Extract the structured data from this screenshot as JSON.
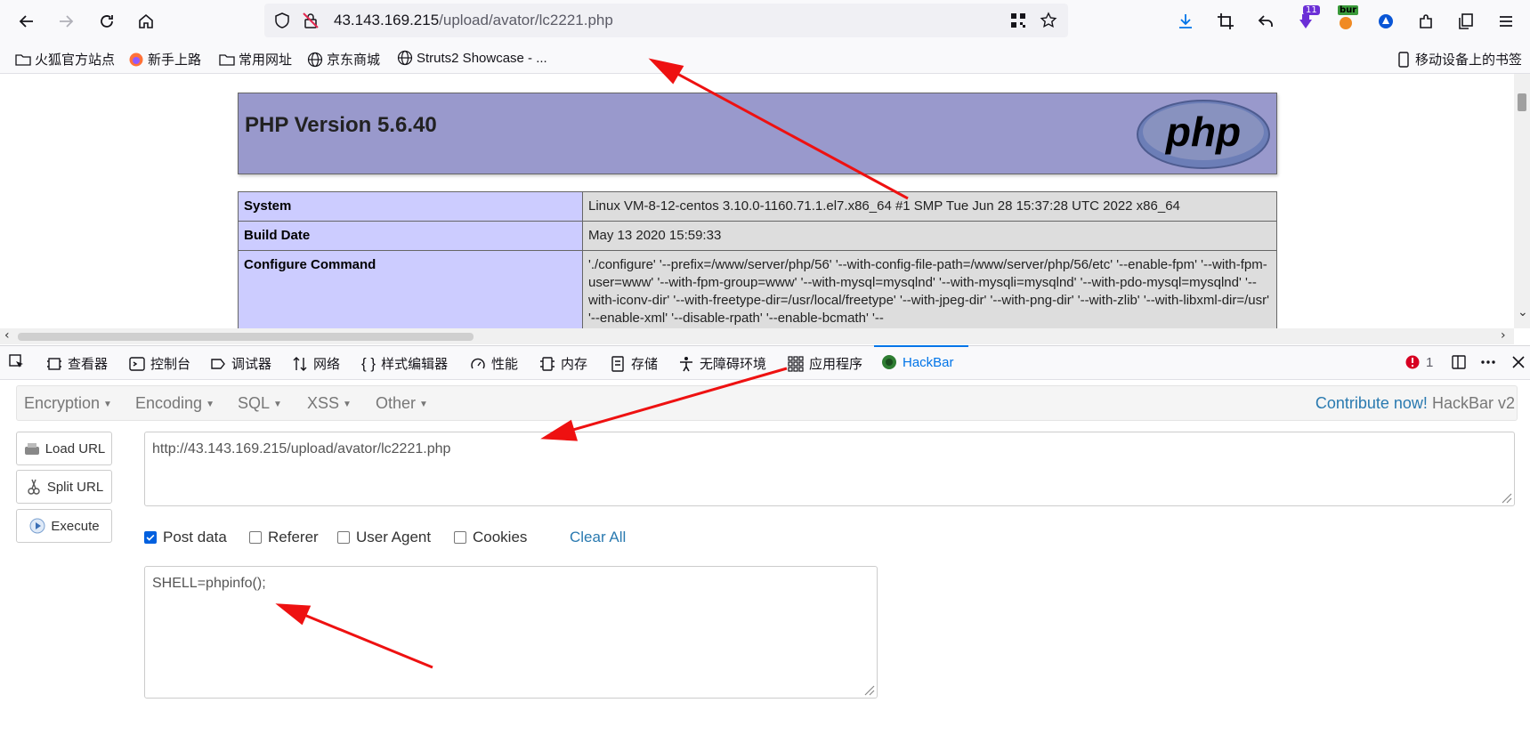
{
  "browser": {
    "url_host": "43.143.169.215",
    "url_path": "/upload/avator/lc2221.php",
    "extension_badge": "11",
    "burp_badge": "bur"
  },
  "bookmarks": [
    {
      "label": "火狐官方站点",
      "icon": "folder-icon"
    },
    {
      "label": "新手上路",
      "icon": "firefox-icon"
    },
    {
      "label": "常用网址",
      "icon": "folder-icon"
    },
    {
      "label": "京东商城",
      "icon": "globe-icon"
    },
    {
      "label": "Struts2 Showcase - ...",
      "icon": "globe-icon"
    }
  ],
  "mobile_bookmarks": "移动设备上的书签",
  "phpinfo": {
    "title": "PHP Version 5.6.40",
    "logo_text": "php",
    "rows": [
      {
        "key": "System",
        "value": "Linux VM-8-12-centos 3.10.0-1160.71.1.el7.x86_64 #1 SMP Tue Jun 28 15:37:28 UTC 2022 x86_64"
      },
      {
        "key": "Build Date",
        "value": "May 13 2020 15:59:33"
      },
      {
        "key": "Configure Command",
        "value": "'./configure' '--prefix=/www/server/php/56' '--with-config-file-path=/www/server/php/56/etc' '--enable-fpm' '--with-fpm-user=www' '--with-fpm-group=www' '--with-mysql=mysqlnd' '--with-mysqli=mysqlnd' '--with-pdo-mysql=mysqlnd' '--with-iconv-dir' '--with-freetype-dir=/usr/local/freetype' '--with-jpeg-dir' '--with-png-dir' '--with-zlib' '--with-libxml-dir=/usr' '--enable-xml' '--disable-rpath' '--enable-bcmath' '--"
      }
    ]
  },
  "devtools": {
    "tabs": [
      "查看器",
      "控制台",
      "调试器",
      "网络",
      "样式编辑器",
      "性能",
      "内存",
      "存储",
      "无障碍环境",
      "应用程序",
      "HackBar"
    ],
    "error_count": "1"
  },
  "hackbar": {
    "menus": [
      "Encryption",
      "Encoding",
      "SQL",
      "XSS",
      "Other"
    ],
    "contribute": "Contribute now!",
    "version": "HackBar v2",
    "buttons": {
      "load": "Load URL",
      "split": "Split URL",
      "execute": "Execute"
    },
    "url_value": "http://43.143.169.215/upload/avator/lc2221.php",
    "options": [
      {
        "label": "Post data",
        "checked": true
      },
      {
        "label": "Referer",
        "checked": false
      },
      {
        "label": "User Agent",
        "checked": false
      },
      {
        "label": "Cookies",
        "checked": false
      }
    ],
    "clear_all": "Clear All",
    "post_value": "SHELL=phpinfo();"
  },
  "colors": {
    "accent": "#0074e8",
    "php_header": "#9999cc",
    "php_key": "#ccccff",
    "php_value": "#dddddd",
    "annotation_arrow": "#ee1111"
  }
}
